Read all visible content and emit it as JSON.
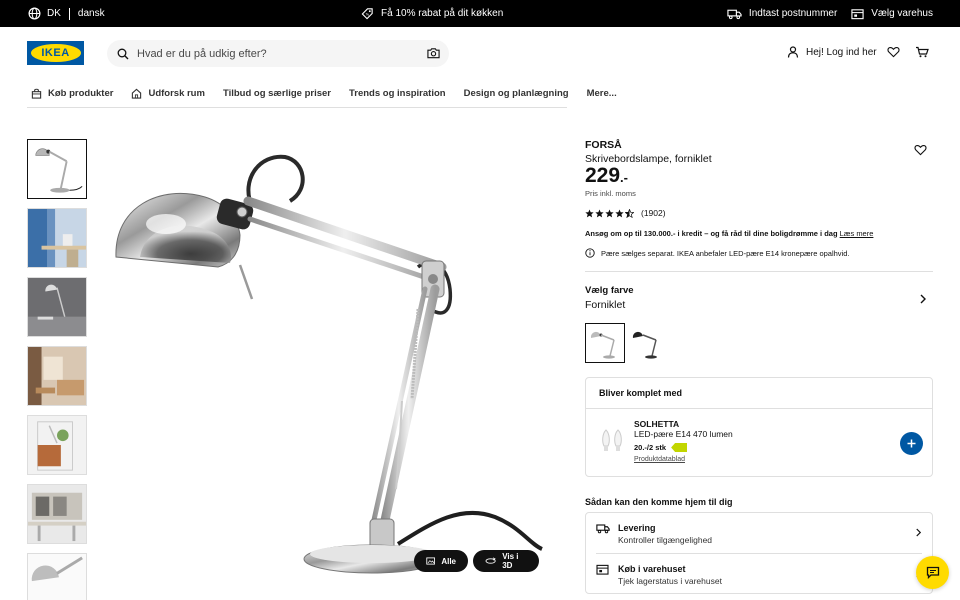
{
  "topbar": {
    "country": "DK",
    "language": "dansk",
    "promo": "Få 10% rabat på dit køkken",
    "postcode": "Indtast postnummer",
    "store": "Vælg varehus"
  },
  "header": {
    "logo_text": "IKEA",
    "search_placeholder": "Hvad er du på udkig efter?",
    "login": "Hej! Log ind her"
  },
  "nav": [
    {
      "label": "Køb produkter",
      "icon": "bag-icon"
    },
    {
      "label": "Udforsk rum",
      "icon": "house-icon"
    },
    {
      "label": "Tilbud og særlige priser"
    },
    {
      "label": "Trends og inspiration"
    },
    {
      "label": "Design og planlægning"
    },
    {
      "label": "Mere..."
    }
  ],
  "gallery": {
    "thumbnail_count": 7,
    "all_button": "Alle",
    "view3d_button": "Vis i 3D"
  },
  "product": {
    "name": "FORSÅ",
    "description": "Skrivebordslampe, forniklet",
    "price": "229",
    "price_suffix": ".-",
    "vat_note": "Pris inkl. moms",
    "rating_stars": 4.5,
    "review_count": "(1902)",
    "credit_text": "Ansøg om op til 130.000.- i kredit – og få råd til dine boligdrømme i dag",
    "credit_link": "Læs mere",
    "bulb_note": "Pære sælges separat. IKEA anbefaler LED-pære E14 kronepære opalhvid.",
    "color_label": "Vælg farve",
    "color_value": "Forniklet"
  },
  "bundle": {
    "heading": "Bliver komplet med",
    "name": "SOLHETTA",
    "description": "LED-pære E14 470 lumen",
    "price": "20.-/2 stk",
    "datasheet": "Produktdatablad"
  },
  "delivery": {
    "heading": "Sådan kan den komme hjem til dig",
    "options": [
      {
        "title": "Levering",
        "subtitle": "Kontroller tilgængelighed",
        "icon": "truck-icon"
      },
      {
        "title": "Køb i varehuset",
        "subtitle": "Tjek lagerstatus i varehuset",
        "icon": "store-icon"
      }
    ]
  },
  "colors": {
    "brand_blue": "#0058a3",
    "brand_yellow": "#ffdb00",
    "energy_green": "#c2d600"
  }
}
